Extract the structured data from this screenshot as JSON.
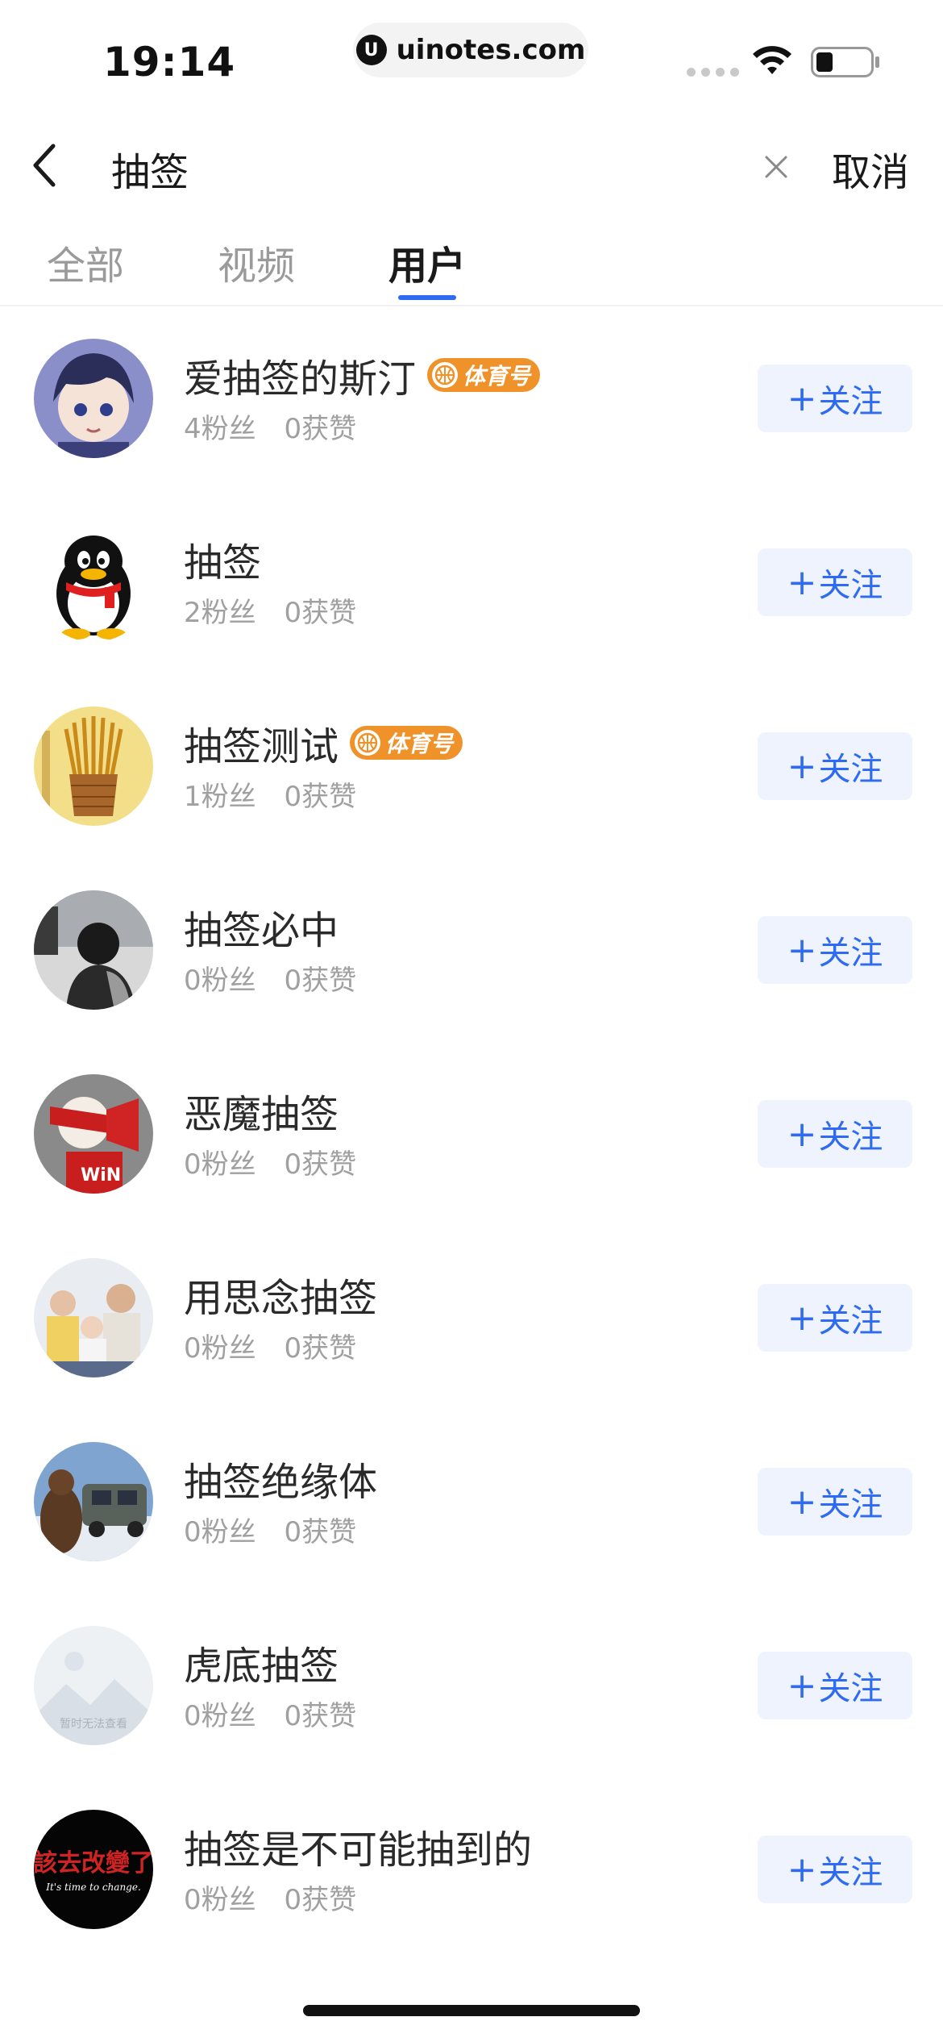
{
  "status_bar": {
    "time": "19:14",
    "url": "uinotes.com",
    "url_logo_letter": "U"
  },
  "search": {
    "query": "抽签",
    "cancel_label": "取消",
    "back_icon": "chevron-left-icon",
    "clear_icon": "close-icon"
  },
  "tabs": [
    {
      "label": "全部",
      "active": false
    },
    {
      "label": "视频",
      "active": false
    },
    {
      "label": "用户",
      "active": true
    }
  ],
  "accent_color": "#2f6bf2",
  "badge_color": "#f0922a",
  "follow_label": "关注",
  "follow_plus": "+",
  "users": [
    {
      "name": "爱抽签的斯汀",
      "badge": "体育号",
      "fans": "4粉丝",
      "likes": "0获赞",
      "avatar": "anime-boy"
    },
    {
      "name": "抽签",
      "badge": "",
      "fans": "2粉丝",
      "likes": "0获赞",
      "avatar": "penguin"
    },
    {
      "name": "抽签测试",
      "badge": "体育号",
      "fans": "1粉丝",
      "likes": "0获赞",
      "avatar": "fortune-sticks"
    },
    {
      "name": "抽签必中",
      "badge": "",
      "fans": "0粉丝",
      "likes": "0获赞",
      "avatar": "person-photo"
    },
    {
      "name": "恶魔抽签",
      "badge": "",
      "fans": "0粉丝",
      "likes": "0获赞",
      "avatar": "win-mascot"
    },
    {
      "name": "用思念抽签",
      "badge": "",
      "fans": "0粉丝",
      "likes": "0获赞",
      "avatar": "family-photo"
    },
    {
      "name": "抽签绝缘体",
      "badge": "",
      "fans": "0粉丝",
      "likes": "0获赞",
      "avatar": "bear-truck"
    },
    {
      "name": "虎底抽签",
      "badge": "",
      "fans": "0粉丝",
      "likes": "0获赞",
      "avatar": "placeholder-image"
    },
    {
      "name": "抽签是不可能抽到的",
      "badge": "",
      "fans": "0粉丝",
      "likes": "0获赞",
      "avatar": "calligraphy"
    }
  ],
  "placeholder_avatar_text": "暂时无法查看",
  "calligraphy_text": "該去改變了",
  "calligraphy_subtext": "It's time to change.",
  "win_text": "WiN"
}
